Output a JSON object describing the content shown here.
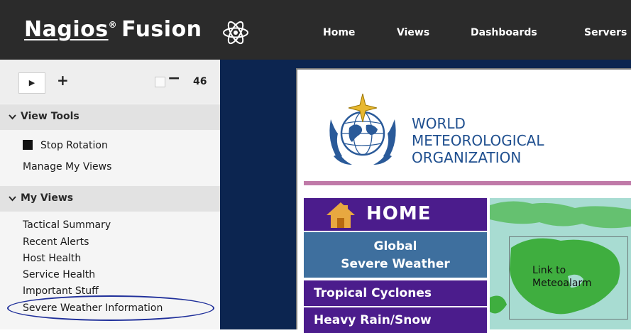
{
  "app": {
    "brand_name": "Nagios",
    "brand_reg": "®",
    "brand_product": "Fusion"
  },
  "nav": {
    "items": [
      {
        "label": "Home"
      },
      {
        "label": "Views"
      },
      {
        "label": "Dashboards"
      },
      {
        "label": "Servers"
      }
    ]
  },
  "controls": {
    "play_symbol": "▶",
    "plus_symbol": "+",
    "minus_symbol": "−",
    "rotation_seconds": "46"
  },
  "view_tools": {
    "header": "View Tools",
    "stop_rotation": "Stop Rotation",
    "manage_views": "Manage My Views"
  },
  "my_views": {
    "header": "My Views",
    "items": [
      {
        "label": "Tactical Summary"
      },
      {
        "label": "Recent Alerts"
      },
      {
        "label": "Host Health"
      },
      {
        "label": "Service Health"
      },
      {
        "label": "Important Stuff"
      },
      {
        "label": "Severe Weather Information"
      }
    ]
  },
  "wmo": {
    "line1": "WORLD",
    "line2": "METEOROLOGICAL",
    "line3": "ORGANIZATION",
    "home": "HOME",
    "global_line1": "Global",
    "global_line2": "Severe Weather",
    "menu": [
      {
        "label": "Tropical Cyclones"
      },
      {
        "label": "Heavy Rain/Snow"
      }
    ],
    "map_link_line1": "Link to",
    "map_link_line2": "Meteoalarm"
  },
  "colors": {
    "topbar": "#2b2b2b",
    "main_bg": "#0c2550",
    "wmo_blue": "#1f4f8f",
    "menu_purple": "#4b1c8c",
    "global_blue": "#3e6f9e",
    "highlight_oval": "#1f2f9a"
  }
}
